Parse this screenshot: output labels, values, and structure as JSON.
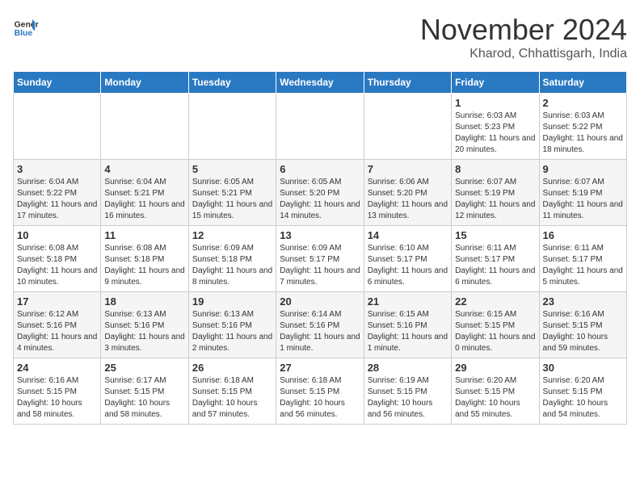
{
  "header": {
    "logo_general": "General",
    "logo_blue": "Blue",
    "month_title": "November 2024",
    "location": "Kharod, Chhattisgarh, India"
  },
  "days_of_week": [
    "Sunday",
    "Monday",
    "Tuesday",
    "Wednesday",
    "Thursday",
    "Friday",
    "Saturday"
  ],
  "weeks": [
    [
      {
        "day": "",
        "info": ""
      },
      {
        "day": "",
        "info": ""
      },
      {
        "day": "",
        "info": ""
      },
      {
        "day": "",
        "info": ""
      },
      {
        "day": "",
        "info": ""
      },
      {
        "day": "1",
        "info": "Sunrise: 6:03 AM\nSunset: 5:23 PM\nDaylight: 11 hours and 20 minutes."
      },
      {
        "day": "2",
        "info": "Sunrise: 6:03 AM\nSunset: 5:22 PM\nDaylight: 11 hours and 18 minutes."
      }
    ],
    [
      {
        "day": "3",
        "info": "Sunrise: 6:04 AM\nSunset: 5:22 PM\nDaylight: 11 hours and 17 minutes."
      },
      {
        "day": "4",
        "info": "Sunrise: 6:04 AM\nSunset: 5:21 PM\nDaylight: 11 hours and 16 minutes."
      },
      {
        "day": "5",
        "info": "Sunrise: 6:05 AM\nSunset: 5:21 PM\nDaylight: 11 hours and 15 minutes."
      },
      {
        "day": "6",
        "info": "Sunrise: 6:05 AM\nSunset: 5:20 PM\nDaylight: 11 hours and 14 minutes."
      },
      {
        "day": "7",
        "info": "Sunrise: 6:06 AM\nSunset: 5:20 PM\nDaylight: 11 hours and 13 minutes."
      },
      {
        "day": "8",
        "info": "Sunrise: 6:07 AM\nSunset: 5:19 PM\nDaylight: 11 hours and 12 minutes."
      },
      {
        "day": "9",
        "info": "Sunrise: 6:07 AM\nSunset: 5:19 PM\nDaylight: 11 hours and 11 minutes."
      }
    ],
    [
      {
        "day": "10",
        "info": "Sunrise: 6:08 AM\nSunset: 5:18 PM\nDaylight: 11 hours and 10 minutes."
      },
      {
        "day": "11",
        "info": "Sunrise: 6:08 AM\nSunset: 5:18 PM\nDaylight: 11 hours and 9 minutes."
      },
      {
        "day": "12",
        "info": "Sunrise: 6:09 AM\nSunset: 5:18 PM\nDaylight: 11 hours and 8 minutes."
      },
      {
        "day": "13",
        "info": "Sunrise: 6:09 AM\nSunset: 5:17 PM\nDaylight: 11 hours and 7 minutes."
      },
      {
        "day": "14",
        "info": "Sunrise: 6:10 AM\nSunset: 5:17 PM\nDaylight: 11 hours and 6 minutes."
      },
      {
        "day": "15",
        "info": "Sunrise: 6:11 AM\nSunset: 5:17 PM\nDaylight: 11 hours and 6 minutes."
      },
      {
        "day": "16",
        "info": "Sunrise: 6:11 AM\nSunset: 5:17 PM\nDaylight: 11 hours and 5 minutes."
      }
    ],
    [
      {
        "day": "17",
        "info": "Sunrise: 6:12 AM\nSunset: 5:16 PM\nDaylight: 11 hours and 4 minutes."
      },
      {
        "day": "18",
        "info": "Sunrise: 6:13 AM\nSunset: 5:16 PM\nDaylight: 11 hours and 3 minutes."
      },
      {
        "day": "19",
        "info": "Sunrise: 6:13 AM\nSunset: 5:16 PM\nDaylight: 11 hours and 2 minutes."
      },
      {
        "day": "20",
        "info": "Sunrise: 6:14 AM\nSunset: 5:16 PM\nDaylight: 11 hours and 1 minute."
      },
      {
        "day": "21",
        "info": "Sunrise: 6:15 AM\nSunset: 5:16 PM\nDaylight: 11 hours and 1 minute."
      },
      {
        "day": "22",
        "info": "Sunrise: 6:15 AM\nSunset: 5:15 PM\nDaylight: 11 hours and 0 minutes."
      },
      {
        "day": "23",
        "info": "Sunrise: 6:16 AM\nSunset: 5:15 PM\nDaylight: 10 hours and 59 minutes."
      }
    ],
    [
      {
        "day": "24",
        "info": "Sunrise: 6:16 AM\nSunset: 5:15 PM\nDaylight: 10 hours and 58 minutes."
      },
      {
        "day": "25",
        "info": "Sunrise: 6:17 AM\nSunset: 5:15 PM\nDaylight: 10 hours and 58 minutes."
      },
      {
        "day": "26",
        "info": "Sunrise: 6:18 AM\nSunset: 5:15 PM\nDaylight: 10 hours and 57 minutes."
      },
      {
        "day": "27",
        "info": "Sunrise: 6:18 AM\nSunset: 5:15 PM\nDaylight: 10 hours and 56 minutes."
      },
      {
        "day": "28",
        "info": "Sunrise: 6:19 AM\nSunset: 5:15 PM\nDaylight: 10 hours and 56 minutes."
      },
      {
        "day": "29",
        "info": "Sunrise: 6:20 AM\nSunset: 5:15 PM\nDaylight: 10 hours and 55 minutes."
      },
      {
        "day": "30",
        "info": "Sunrise: 6:20 AM\nSunset: 5:15 PM\nDaylight: 10 hours and 54 minutes."
      }
    ]
  ]
}
